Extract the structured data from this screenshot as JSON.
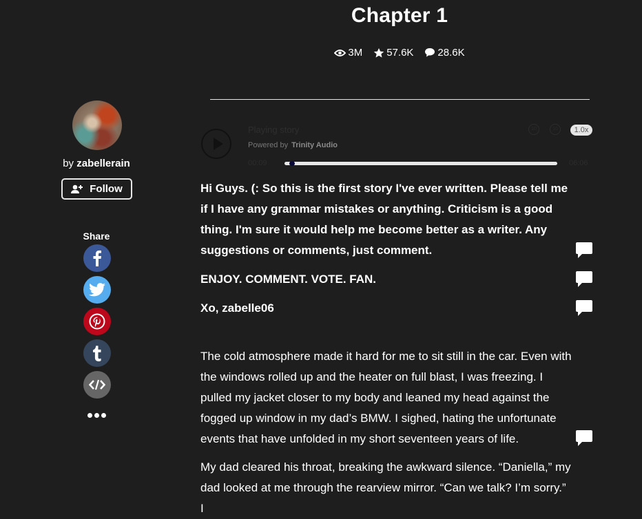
{
  "chapter": {
    "title": "Chapter 1",
    "stats": {
      "reads": "3M",
      "votes": "57.6K",
      "comments": "28.6K"
    }
  },
  "audio_player": {
    "status": "Playing story",
    "powered_by_label": "Powered by",
    "powered_by_brand": "Trinity Audio",
    "current_time": "00:09",
    "total_time": "06:06",
    "progress_fraction": 0.025,
    "rewind_label": "10",
    "forward_label": "10",
    "speed": "1.0x"
  },
  "author": {
    "by_label": "by",
    "username": "zabellerain",
    "follow_label": "Follow"
  },
  "share": {
    "label": "Share",
    "items": [
      {
        "name": "facebook",
        "color": "#3b5998"
      },
      {
        "name": "twitter",
        "color": "#55acee"
      },
      {
        "name": "pinterest",
        "color": "#bd081c"
      },
      {
        "name": "tumblr",
        "color": "#35465c"
      },
      {
        "name": "embed",
        "color": "#666666"
      }
    ]
  },
  "paragraphs": [
    {
      "text": "Hi Guys. (: So this is the first story I've ever written. Please tell me if I have any grammar mistakes or anything. Criticism is a good thing. I'm sure it would help me become better as a writer. Any suggestions or comments, just comment.",
      "bold": true
    },
    {
      "text": "ENJOY. COMMENT. VOTE. FAN.",
      "bold": true
    },
    {
      "text": "Xo, zabelle06",
      "bold": true
    },
    {
      "text": "The cold atmosphere made it hard for me to sit still in the car. Even with the windows rolled up and the heater on full blast, I was freezing. I pulled my jacket closer to my body and leaned my head against the fogged up window in my dad’s BMW. I sighed, hating the unfortunate events that have unfolded in my short seventeen years of life.",
      "bold": false
    },
    {
      "text": "My dad cleared his throat, breaking the awkward silence. “Daniella,” my dad looked at me through the rearview mirror. “Can we talk? I’m sorry.” I",
      "bold": false
    }
  ]
}
